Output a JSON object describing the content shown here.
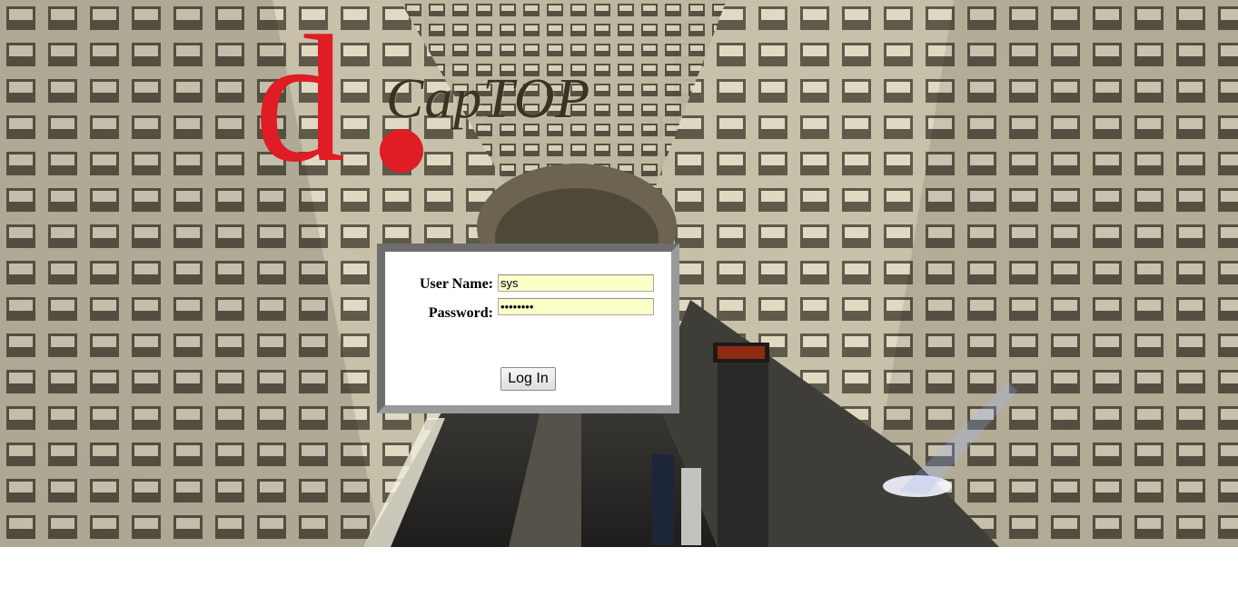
{
  "logo": {
    "letter": "d",
    "wordmark": "CapTOP",
    "brand_color": "#e01c24",
    "wordmark_color": "#3a3422"
  },
  "background": {
    "description_icon": "metro-tunnel-photo"
  },
  "login": {
    "username_label": "User Name:",
    "username_value": "sys",
    "password_label": "Password:",
    "password_value": "••••••••",
    "submit_label": "Log In",
    "field_background": "#fbffc8"
  }
}
